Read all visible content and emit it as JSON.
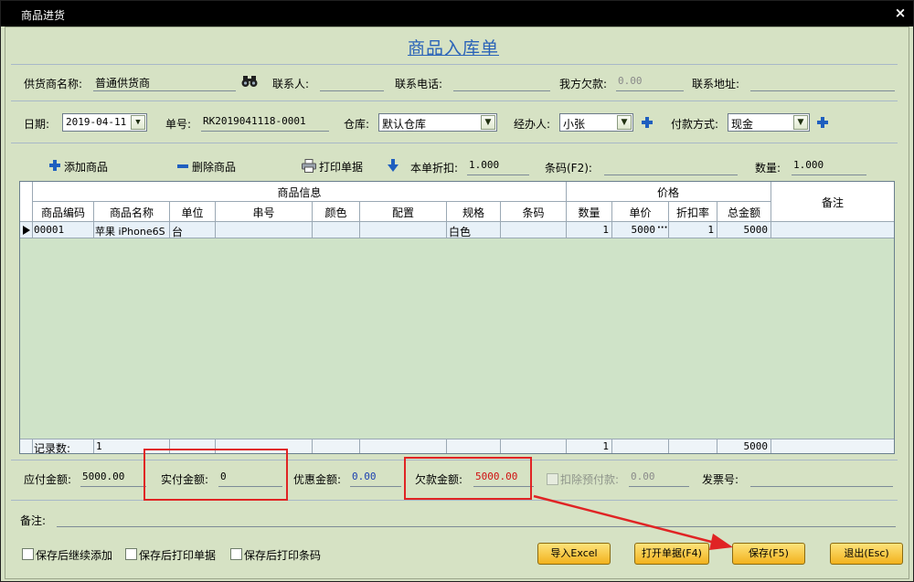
{
  "window": {
    "title": "商品进货",
    "close_glyph": "×"
  },
  "form": {
    "heading": "商品入库单"
  },
  "row1": {
    "supplier_label": "供货商名称:",
    "supplier_value": "普通供货商",
    "contact_label": "联系人:",
    "contact_value": "",
    "phone_label": "联系电话:",
    "phone_value": "",
    "debt_label": "我方欠款:",
    "debt_value": "0.00",
    "address_label": "联系地址:",
    "address_value": ""
  },
  "row2": {
    "date_label": "日期:",
    "date_value": "2019-04-11",
    "order_label": "单号:",
    "order_value": "RK2019041118-0001",
    "warehouse_label": "仓库:",
    "warehouse_value": "默认仓库",
    "handler_label": "经办人:",
    "handler_value": "小张",
    "payment_label": "付款方式:",
    "payment_value": "现金"
  },
  "toolbar": {
    "add_label": "添加商品",
    "delete_label": "删除商品",
    "print_label": "打印单据",
    "discount_label": "本单折扣:",
    "discount_value": "1.000",
    "barcode_label": "条码(F2):",
    "barcode_value": "",
    "qty_label": "数量:",
    "qty_value": "1.000"
  },
  "grid": {
    "group_product": "商品信息",
    "group_price": "价格",
    "remark_header": "备注",
    "columns": [
      "商品编码",
      "商品名称",
      "单位",
      "串号",
      "颜色",
      "配置",
      "规格",
      "条码",
      "数量",
      "单价",
      "折扣率",
      "总金额"
    ],
    "row": [
      "00001",
      "苹果 iPhone6S",
      "台",
      "",
      "",
      "",
      "白色",
      "",
      "1",
      "5000",
      "1",
      "5000"
    ],
    "row_ellipsis": "···",
    "footer": {
      "label": "记录数:",
      "count": "1",
      "qty": "1",
      "total": "5000"
    }
  },
  "payment": {
    "payable_label": "应付金额:",
    "payable_value": "5000.00",
    "paid_label": "实付金额:",
    "paid_value": "0",
    "discount_label": "优惠金额:",
    "discount_value": "0.00",
    "owed_label": "欠款金额:",
    "owed_value": "5000.00",
    "prepaid_label": "扣除预付款:",
    "prepaid_value": "0.00",
    "invoice_label": "发票号:",
    "invoice_value": ""
  },
  "remark": {
    "label": "备注:",
    "value": ""
  },
  "options": {
    "continue_add": "保存后继续添加",
    "print_doc": "保存后打印单据",
    "print_barcode": "保存后打印条码"
  },
  "buttons": {
    "import_excel": "导入Excel",
    "open_doc": "打开单据(F4)",
    "save": "保存(F5)",
    "exit": "退出(Esc)"
  },
  "colors": {
    "accent": "#2a63b8",
    "highlight": "#e02424",
    "owed_text": "#d01010",
    "discount_text": "#1a3fb0"
  },
  "icons": [
    "binoculars-icon",
    "chevron-down-icon",
    "plus-icon",
    "minus-icon",
    "printer-icon",
    "down-arrow-icon",
    "row-pointer-icon"
  ]
}
